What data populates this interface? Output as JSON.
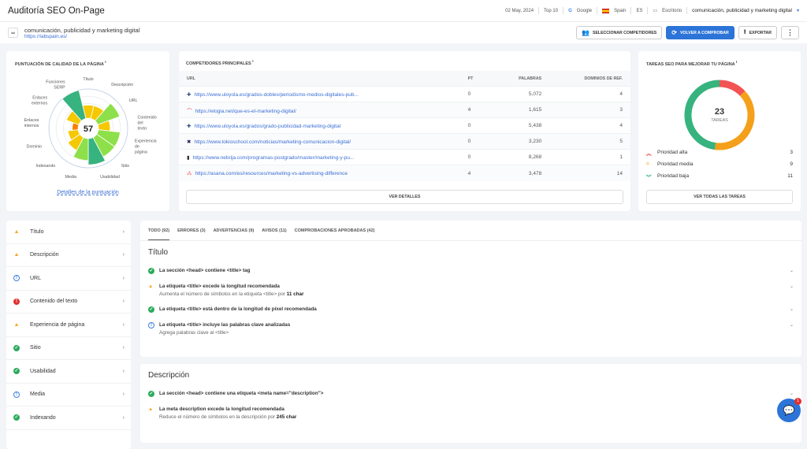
{
  "header": {
    "title": "Auditoría SEO On-Page",
    "date": "02 May, 2024",
    "top": "Top 10",
    "engine": "Google",
    "country": "Spain",
    "lang": "ES",
    "device": "Escritorio",
    "keyword": "comunicación, publicidad y marketing digital"
  },
  "site": {
    "favicon": "iab",
    "name": "comunicación, publicidad y marketing digital",
    "url": "https://iabspain.es/"
  },
  "actions": {
    "competitors": "SELECCIONAR COMPETIDORES",
    "recheck": "VOLVER A COMPROBAR",
    "export": "EXPORTAR"
  },
  "score": {
    "title": "PUNTUACIÓN DE CALIDAD DE LA PÁGINA",
    "info": "i",
    "value": "57",
    "details_link": "Detalles de la puntuación"
  },
  "chart_data": {
    "type": "polar-area",
    "center_value": 57,
    "categories": [
      "Título",
      "Descripción",
      "URL",
      "Contenido del texto",
      "Experiencia de página",
      "Sitio",
      "Usabilidad",
      "Media",
      "Indexando",
      "Dominio",
      "Enlaces internos",
      "Enlaces externos",
      "Funciones SERP"
    ],
    "values": [
      45,
      45,
      80,
      40,
      75,
      75,
      90,
      75,
      50,
      35,
      20,
      45,
      100
    ],
    "colors": [
      "#f5c800",
      "#f5c800",
      "#8ee04a",
      "#f5c800",
      "#8ee04a",
      "#8ee04a",
      "#36b37e",
      "#8ee04a",
      "#f5c800",
      "#f5c800",
      "#f77f00",
      "#f5c800",
      "#36b37e"
    ]
  },
  "competitors": {
    "title": "COMPETIDORES PRINCIPALES",
    "info": "i",
    "columns": [
      "URL",
      "PT",
      "PALABRAS",
      "DOMINIOS DE REF."
    ],
    "rows": [
      {
        "url": "https://www.uloyola.es/grados-dobles/periodismo-medios-digitales-pub...",
        "pt": "0",
        "words": "5,072",
        "refs": "4",
        "icon": "✚",
        "color": "#2a4a8a"
      },
      {
        "url": "https://elogia.net/que-es-el-marketing-digital/",
        "pt": "4",
        "words": "1,615",
        "refs": "3",
        "icon": "⌒",
        "color": "#e03030"
      },
      {
        "url": "https://www.uloyola.es/grados/grado-publicidad-marketing-digital",
        "pt": "0",
        "words": "5,438",
        "refs": "4",
        "icon": "✚",
        "color": "#2a4a8a"
      },
      {
        "url": "https://www.tokioschool.com/noticias/marketing-comunicacion-digital/",
        "pt": "0",
        "words": "3,230",
        "refs": "5",
        "icon": "✖",
        "color": "#1a1a5a"
      },
      {
        "url": "https://www.nebrija.com/programas-postgrado/master/marketing-y-pu...",
        "pt": "0",
        "words": "8,268",
        "refs": "1",
        "icon": "▮",
        "color": "#333"
      },
      {
        "url": "https://asana.com/es/resources/marketing-vs-advertising-difference",
        "pt": "4",
        "words": "3,478",
        "refs": "14",
        "icon": "⁂",
        "color": "#f06a6a"
      }
    ],
    "button": "VER DETALLES"
  },
  "tasks": {
    "title": "TAREAS SEO PARA MEJORAR TU PÁGINA",
    "info": "i",
    "total": "23",
    "label": "TAREAS",
    "items": [
      {
        "label": "Prioridad alta",
        "count": "3",
        "color": "#f25454",
        "icon": "︽"
      },
      {
        "label": "Prioridad media",
        "count": "9",
        "color": "#f5a01a",
        "icon": "="
      },
      {
        "label": "Prioridad baja",
        "count": "11",
        "color": "#36b37e",
        "icon": "︾"
      }
    ],
    "button": "VER TODAS LAS TAREAS"
  },
  "sidebar": [
    {
      "label": "Título",
      "status": "warning"
    },
    {
      "label": "Descripción",
      "status": "warning"
    },
    {
      "label": "URL",
      "status": "info"
    },
    {
      "label": "Contenido del texto",
      "status": "error"
    },
    {
      "label": "Experiencia de página",
      "status": "warning"
    },
    {
      "label": "Sitio",
      "status": "ok"
    },
    {
      "label": "Usabilidad",
      "status": "ok"
    },
    {
      "label": "Media",
      "status": "info"
    },
    {
      "label": "Indexando",
      "status": "ok"
    }
  ],
  "tabs": [
    "TODO (92)",
    "ERRORES (3)",
    "ADVERTENCIAS (9)",
    "AVISOS (11)",
    "COMPROBACIONES APROBADAS (42)"
  ],
  "sections": [
    {
      "title": "Título",
      "checks": [
        {
          "status": "ok",
          "text": "La sección <head> contiene <title> tag",
          "desc": "",
          "strong": ""
        },
        {
          "status": "warning",
          "text": "La etiqueta <title> excede la longitud recomendada",
          "desc": "Aumenta el número de símbolos en la etiqueta <title> por ",
          "strong": "11 char"
        },
        {
          "status": "ok",
          "text": "La etiqueta <title> está dentro de la longitud de píxel recomendada",
          "desc": "",
          "strong": ""
        },
        {
          "status": "info",
          "text": "La etiqueta <title> incluye las palabras clave analizadas",
          "desc": "Agrega palabras clave al <title>",
          "strong": ""
        }
      ]
    },
    {
      "title": "Descripción",
      "checks": [
        {
          "status": "ok",
          "text": "La sección <head> contiene una etiqueta <meta name=\"description\">",
          "desc": "",
          "strong": ""
        },
        {
          "status": "warning",
          "text": "La meta description excede la longitud recomendada",
          "desc": "Reduce el número de símbolos en la descripción por ",
          "strong": "245 char"
        }
      ]
    }
  ],
  "chat": {
    "badge": "1"
  }
}
